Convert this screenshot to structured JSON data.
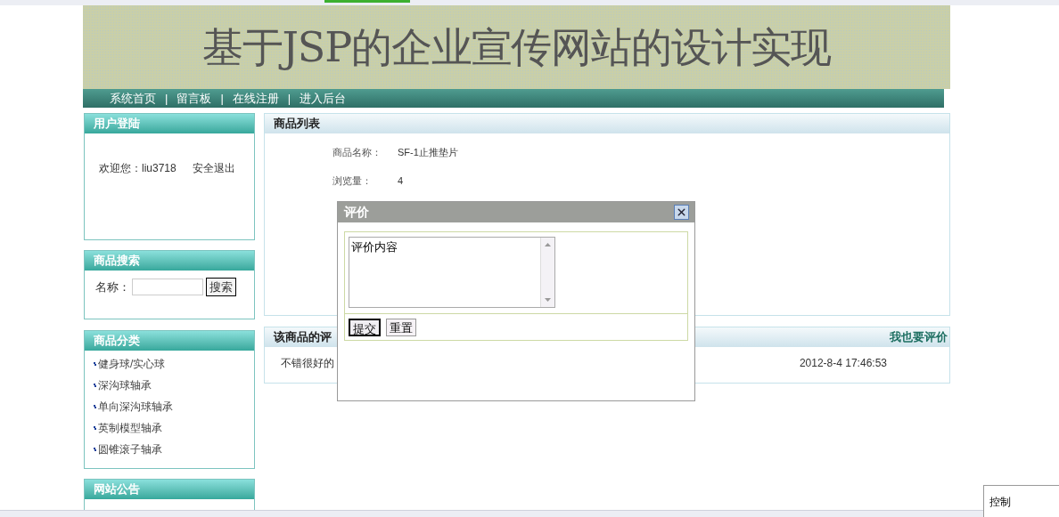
{
  "banner": {
    "title": "基于JSP的企业宣传网站的设计实现"
  },
  "nav": {
    "items": [
      {
        "label": "系统首页"
      },
      {
        "label": "留言板"
      },
      {
        "label": "在线注册"
      },
      {
        "label": "进入后台"
      }
    ],
    "separators": [
      "|",
      "|",
      "|"
    ]
  },
  "login": {
    "title": "用户登陆",
    "welcome": "欢迎您：liu3718",
    "logout": "安全退出"
  },
  "search": {
    "title": "商品搜索",
    "label": "名称：",
    "button": "搜索"
  },
  "categories": {
    "title": "商品分类",
    "items": [
      "健身球/实心球",
      "深沟球轴承",
      "单向深沟球轴承",
      "英制模型轴承",
      "圆锥滚子轴承"
    ]
  },
  "notice": {
    "title": "网站公告"
  },
  "product": {
    "title": "商品列表",
    "fields": [
      {
        "label": "商品名称：",
        "value": "SF-1止推垫片"
      },
      {
        "label": "浏览量：",
        "value": "4"
      }
    ]
  },
  "reviews": {
    "title": "该商品的评",
    "action": "我也要评价",
    "rows": [
      {
        "text": "不错很好的",
        "time": "2012-8-4 17:46:53"
      }
    ]
  },
  "dialog": {
    "title": "评价",
    "content": "评价内容",
    "buttons": [
      {
        "label": "提交",
        "focused": true
      },
      {
        "label": "重置",
        "focused": false
      }
    ]
  },
  "control_panel": {
    "title": "控制"
  }
}
